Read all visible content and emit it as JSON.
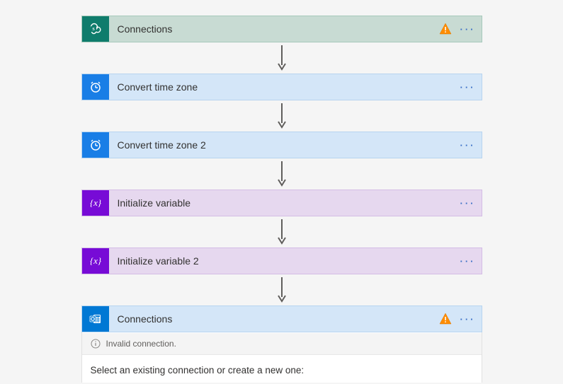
{
  "steps": [
    {
      "label": "Connections",
      "type": "sharepoint",
      "bg": "green",
      "warning": true
    },
    {
      "label": "Convert time zone",
      "type": "clock",
      "bg": "blue",
      "warning": false
    },
    {
      "label": "Convert time zone 2",
      "type": "clock",
      "bg": "blue",
      "warning": false
    },
    {
      "label": "Initialize variable",
      "type": "variable",
      "bg": "purple",
      "warning": false
    },
    {
      "label": "Initialize variable 2",
      "type": "variable",
      "bg": "purple",
      "warning": false
    },
    {
      "label": "Connections",
      "type": "outlook",
      "bg": "blue",
      "warning": true,
      "expanded": true
    }
  ],
  "expanded": {
    "invalid_message": "Invalid connection.",
    "select_prompt": "Select an existing connection or create a new one:"
  }
}
